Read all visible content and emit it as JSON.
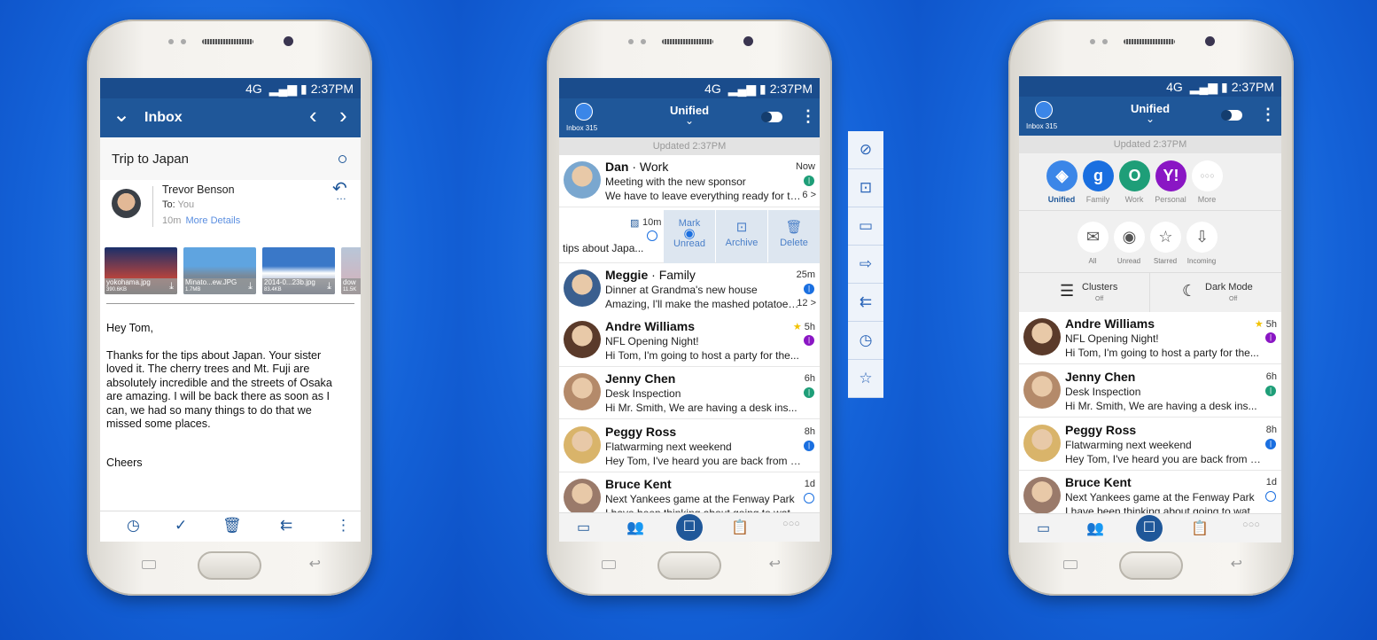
{
  "colors": {
    "header": "#1f5799",
    "status_bar": "#1a4c8c",
    "accent": "#1a6fe0",
    "green": "#1e9e78",
    "purple": "#8a16c4",
    "star": "#f2c200"
  },
  "status_bar": {
    "network": "4G",
    "time": "2:37PM"
  },
  "screen1": {
    "header": {
      "title": "Inbox",
      "back_icon": "chevron-down-icon",
      "prev_icon": "chevron-left-icon",
      "next_icon": "chevron-right-icon"
    },
    "subject": "Trip to Japan",
    "sender": {
      "name": "Trevor Benson",
      "to_label": "To:",
      "to_value": "You",
      "time": "10m",
      "more_details": "More Details"
    },
    "attachments": [
      {
        "name": "yokohama.jpg",
        "size": "390.6KB"
      },
      {
        "name": "Minato...ew.JPG",
        "size": "1.7MB"
      },
      {
        "name": "2014-0...23b.jpg",
        "size": "83.4KB"
      },
      {
        "name": "dow",
        "size": "11.5K"
      }
    ],
    "body": {
      "greeting": "Hey Tom,",
      "paragraph": "Thanks for the tips about Japan. Your sister loved it. The cherry trees and Mt. Fuji are absolutely incredible and the streets of Osaka are amazing. I will be back there as soon as I can, we had so many things to do that we missed some places.",
      "closing": "Cheers"
    },
    "toolbar": [
      "snooze-icon",
      "check-icon",
      "trash-icon",
      "reply-all-icon",
      "more-vertical-icon"
    ]
  },
  "screen2": {
    "header": {
      "title": "Unified",
      "inbox_label": "Inbox 315"
    },
    "updated": "Updated 2:37PM",
    "emails": [
      {
        "name": "Dan",
        "account": "Work",
        "subject": "Meeting with the new sponsor",
        "preview": "We have to leave everything ready for to...",
        "time": "Now",
        "dot": "#1e9e78",
        "count": "6 >"
      },
      {
        "name": "Meggie",
        "account": "Family",
        "subject": "Dinner at Grandma's new house",
        "preview": "Amazing, I'll make the mashed potatoes a...",
        "time": "25m",
        "dot": "#1a6fe0",
        "count": "12 >"
      },
      {
        "name": "Andre Williams",
        "account": "",
        "subject": "NFL Opening Night!",
        "preview": "Hi Tom, I'm going to host a party for the...",
        "time": "5h",
        "dot": "#8a16c4",
        "starred": true
      },
      {
        "name": "Jenny Chen",
        "account": "",
        "subject": "Desk Inspection",
        "preview": "Hi Mr. Smith, We are having a desk ins...",
        "time": "6h",
        "dot": "#1e9e78"
      },
      {
        "name": "Peggy Ross",
        "account": "",
        "subject": "Flatwarming next weekend",
        "preview": "Hey Tom, I've heard you are back from yo...",
        "time": "8h",
        "dot": "#1a6fe0"
      },
      {
        "name": "Bruce Kent",
        "account": "",
        "subject": "Next Yankees game at the Fenway Park",
        "preview": "I have been thinking about going to watc...",
        "time": "1d",
        "dot": "empty"
      }
    ],
    "swiped": {
      "preview": "tips about Japa...",
      "time": "10m",
      "actions": [
        {
          "label1": "Mark",
          "label2": "Unread"
        },
        {
          "label1": "",
          "label2": "Archive"
        },
        {
          "label1": "",
          "label2": "Delete"
        }
      ]
    }
  },
  "side_actions": [
    "block-icon",
    "archive-icon",
    "folder-icon",
    "forward-icon",
    "reply-all-icon",
    "snooze-icon",
    "star-icon"
  ],
  "screen3": {
    "header": {
      "title": "Unified",
      "inbox_label": "Inbox 315"
    },
    "updated": "Updated 2:37PM",
    "accounts": [
      {
        "label": "Unified",
        "color": "#3b86e8",
        "glyph": "◈",
        "active": true
      },
      {
        "label": "Family",
        "color": "#1a6fe0",
        "glyph": "g"
      },
      {
        "label": "Work",
        "color": "#1e9e78",
        "glyph": "O"
      },
      {
        "label": "Personal",
        "color": "#8a16c4",
        "glyph": "Y!"
      },
      {
        "label": "More",
        "color": "#ffffff",
        "glyph": "○○○"
      }
    ],
    "filters": [
      {
        "label": "All",
        "glyph": "✉"
      },
      {
        "label": "Unread",
        "glyph": "◉"
      },
      {
        "label": "Starred",
        "glyph": "☆"
      },
      {
        "label": "Incoming",
        "glyph": "⇩"
      }
    ],
    "toggles": [
      {
        "label": "Clusters",
        "state": "Off"
      },
      {
        "label": "Dark Mode",
        "state": "Off"
      }
    ],
    "emails": [
      {
        "name": "Andre Williams",
        "account": "",
        "subject": "NFL Opening Night!",
        "preview": "Hi Tom, I'm going to host a party for the...",
        "time": "5h",
        "dot": "#8a16c4",
        "starred": true
      },
      {
        "name": "Jenny Chen",
        "account": "",
        "subject": "Desk Inspection",
        "preview": "Hi Mr. Smith, We are having a desk ins...",
        "time": "6h",
        "dot": "#1e9e78"
      },
      {
        "name": "Peggy Ross",
        "account": "",
        "subject": "Flatwarming next weekend",
        "preview": "Hey Tom, I've heard you are back from yo...",
        "time": "8h",
        "dot": "#1a6fe0"
      },
      {
        "name": "Bruce Kent",
        "account": "",
        "subject": "Next Yankees game at the Fenway Park",
        "preview": "I have been thinking about going to watc...",
        "time": "1d",
        "dot": "empty"
      }
    ]
  },
  "bottom_nav": [
    "inbox-icon",
    "contacts-icon",
    "compose-icon",
    "tasks-icon",
    "more-icon"
  ]
}
